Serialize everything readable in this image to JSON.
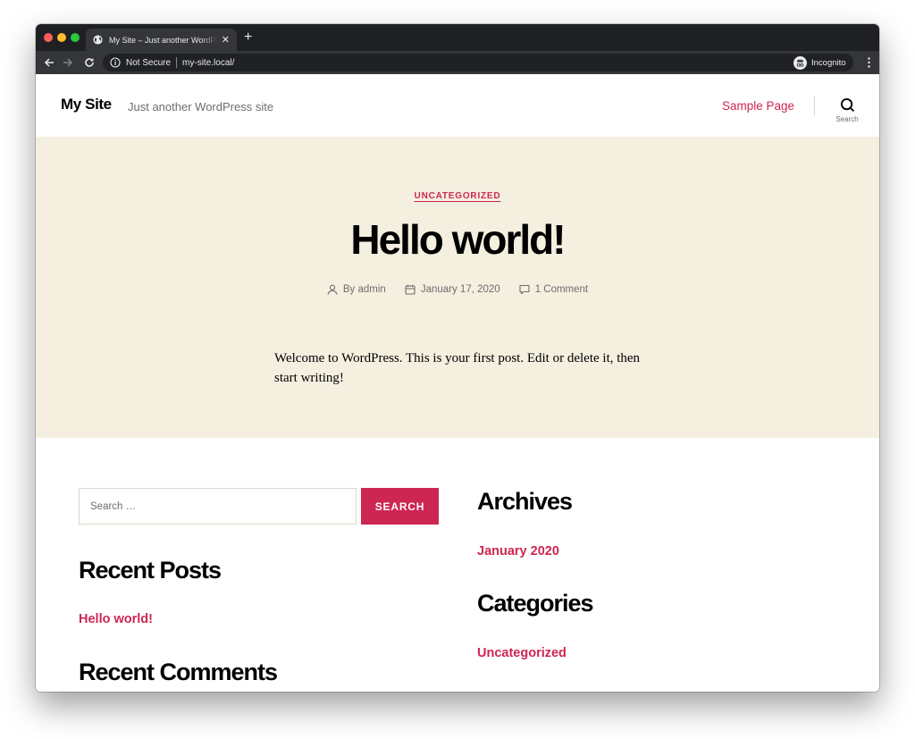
{
  "browser": {
    "tab": {
      "title": "My Site – Just another WordPress site",
      "favicon": "globe-icon"
    },
    "new_tab_symbol": "+",
    "close_symbol": "✕",
    "address": {
      "security_label": "Not Secure",
      "url": "my-site.local/"
    },
    "profile_label": "Incognito"
  },
  "header": {
    "site_title": "My Site",
    "site_description": "Just another WordPress site",
    "nav": [
      {
        "label": "Sample Page"
      }
    ],
    "search_toggle_label": "Search"
  },
  "post": {
    "category": "UNCATEGORIZED",
    "title": "Hello world!",
    "meta": {
      "author": "By admin",
      "date": "January 17, 2020",
      "comments": "1 Comment"
    },
    "body": "Welcome to WordPress. This is your first post. Edit or delete it, then start writing!"
  },
  "widgets": {
    "search": {
      "placeholder": "Search …",
      "value": "",
      "button_label": "SEARCH"
    },
    "recent_posts": {
      "title": "Recent Posts",
      "items": [
        "Hello world!"
      ]
    },
    "recent_comments": {
      "title": "Recent Comments"
    },
    "archives": {
      "title": "Archives",
      "items": [
        "January 2020"
      ]
    },
    "categories": {
      "title": "Categories",
      "items": [
        "Uncategorized"
      ]
    }
  },
  "colors": {
    "accent": "#cd2653",
    "hero_background": "#f5efe0",
    "chrome_dark": "#1f2023",
    "chrome_toolbar": "#35363a"
  }
}
